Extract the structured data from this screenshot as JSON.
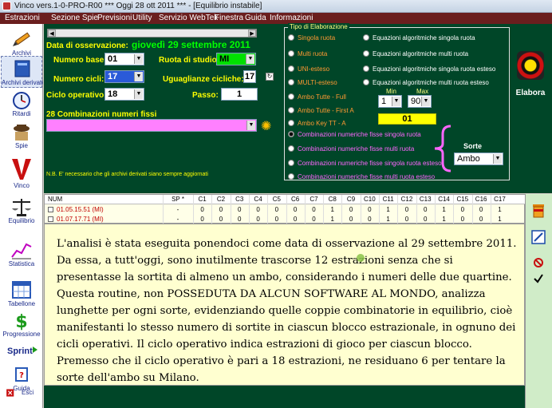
{
  "window": {
    "title": "Vinco vers.1-0-PRO-R00  ***  Oggi 28 ott 2011  ***  - [Equilibrio instabile]"
  },
  "menu": [
    "Estrazioni",
    "Sezione Spie",
    "Previsioni",
    "Utility",
    "Servizio WebTek",
    "Finestra",
    "Guida",
    "Informazioni"
  ],
  "sidebar": {
    "items": [
      {
        "label": "Archivi",
        "icon": "pencil-icon"
      },
      {
        "label": "Archivi derivati",
        "icon": "book-icon"
      },
      {
        "label": "Ritardi",
        "icon": "stopwatch-icon"
      },
      {
        "label": "Spie",
        "icon": "spy-icon"
      },
      {
        "label": "Vinco",
        "icon": "vinco-logo-icon"
      },
      {
        "label": "Equilibrio",
        "icon": "balance-icon"
      },
      {
        "label": "Statistica",
        "icon": "chart-icon"
      },
      {
        "label": "Tabellone",
        "icon": "calendar-icon"
      },
      {
        "label": "Progressione",
        "icon": "dollar-icon"
      },
      {
        "label": "Sprint",
        "icon": "sprint-icon"
      },
      {
        "label": "Guida",
        "icon": "help-book-icon"
      },
      {
        "label": "Esci",
        "icon": "exit-icon"
      }
    ]
  },
  "form": {
    "data_label": "Data di osservazione:",
    "data_value": "giovedì 29 settembre 2011",
    "numero_base_label": "Numero base:",
    "numero_base_value": "01",
    "ruota_label": "Ruota di studio:",
    "ruota_value": "MI",
    "numero_cicli_label": "Numero cicli:",
    "numero_cicli_value": "17",
    "uguaglianze_label": "Uguaglianze cicliche:",
    "uguaglianze_value": "17",
    "ciclo_label": "Ciclo operativo:",
    "ciclo_value": "18",
    "passo_label": "Passo:",
    "passo_value": "1",
    "combinazioni_label": "28 Combinazioni numeri fissi",
    "note": "N.B. E' necessario che gli archivi derivati siano sempre aggiornati"
  },
  "elaborazione": {
    "title": "Tipo di Elaborazione",
    "left_options": [
      {
        "label": "Singola ruota",
        "color": "#ff9933"
      },
      {
        "label": "Multi ruota",
        "color": "#ff9933"
      },
      {
        "label": "UNI-esteso",
        "color": "#ff9933"
      },
      {
        "label": "MULTI-esteso",
        "color": "#ff9933"
      },
      {
        "label": "Ambo Tutte - Full",
        "color": "#ff9933"
      },
      {
        "label": "Ambo Tutte - First A",
        "color": "#ff9933"
      },
      {
        "label": "Ambo Key TT -  A",
        "color": "#ff9933"
      }
    ],
    "right_options": [
      "Equazioni algoritmiche singola ruota",
      "Equazioni algoritmiche multi ruota",
      "Equazioni algoritmiche singola ruota esteso",
      "Equazioni algoritmiche multi ruota esteso"
    ],
    "bottom_options": [
      {
        "label": "Combinazioni numeriche fisse singola ruota",
        "selected": true
      },
      {
        "label": "Combinazioni numeriche fisse multi ruota",
        "selected": false
      },
      {
        "label": "Combinazioni numeriche fisse singola ruota esteso",
        "selected": false
      },
      {
        "label": "Combinazioni numeriche fisse multi ruota esteso",
        "selected": false
      }
    ],
    "min_label": "Min",
    "max_label": "Max",
    "min_value": "1",
    "max_value": "90",
    "key_value": "01",
    "sorte_label": "Sorte",
    "sorte_value": "Ambo",
    "elabora_label": "Elabora"
  },
  "table": {
    "headers": [
      "NUM",
      "SP *",
      "C1",
      "C2",
      "C3",
      "C4",
      "C5",
      "C6",
      "C7",
      "C8",
      "C9",
      "C10",
      "C11",
      "C12",
      "C13",
      "C14",
      "C15",
      "C16",
      "C17"
    ],
    "rows": [
      {
        "num": "01.05.15.51  (MI)",
        "sp": "-",
        "cells": [
          "0",
          "0",
          "0",
          "0",
          "0",
          "0",
          "0",
          "1",
          "0",
          "0",
          "1",
          "0",
          "0",
          "1",
          "0",
          "0",
          "1"
        ]
      },
      {
        "num": "01.07.17.71  (MI)",
        "sp": "-",
        "cells": [
          "0",
          "0",
          "0",
          "0",
          "0",
          "0",
          "0",
          "1",
          "0",
          "0",
          "1",
          "0",
          "0",
          "1",
          "0",
          "0",
          "1"
        ]
      }
    ]
  },
  "report_text": "L'analisi è stata eseguita ponendoci come data di osservazione al 29 settembre 2011. Da essa,  a tutt'oggi, sono inutilmente trascorse 12 estrazioni  senza che si presentasse la sortita di almeno un ambo, considerando i numeri delle due quartine. Questa routine, non POSSEDUTA DA ALCUN SOFTWARE AL MONDO, analizza lunghette per ogni sorte, evidenziando quelle coppie combinatorie in equilibrio, cioè manifestanti lo stesso numero di sortite in ciascun blocco estrazionale, in ognuno dei cicli operativi. Il ciclo operativo indica estrazioni di gioco per ciascun blocco. Premesso che il ciclo operativo è pari a 18 estrazioni, ne residuano 6 per tentare la sorte dell'ambo su Milano.",
  "right_panel": {
    "icons": [
      "trash-icon",
      "edit-icon",
      "cancel-icon",
      "check-icon"
    ]
  },
  "colors": {
    "panel_bg": "#004628",
    "label_yellow": "#ffff00",
    "menu_bg": "#6a1e1e",
    "text_area_bg": "#ffffd0"
  }
}
